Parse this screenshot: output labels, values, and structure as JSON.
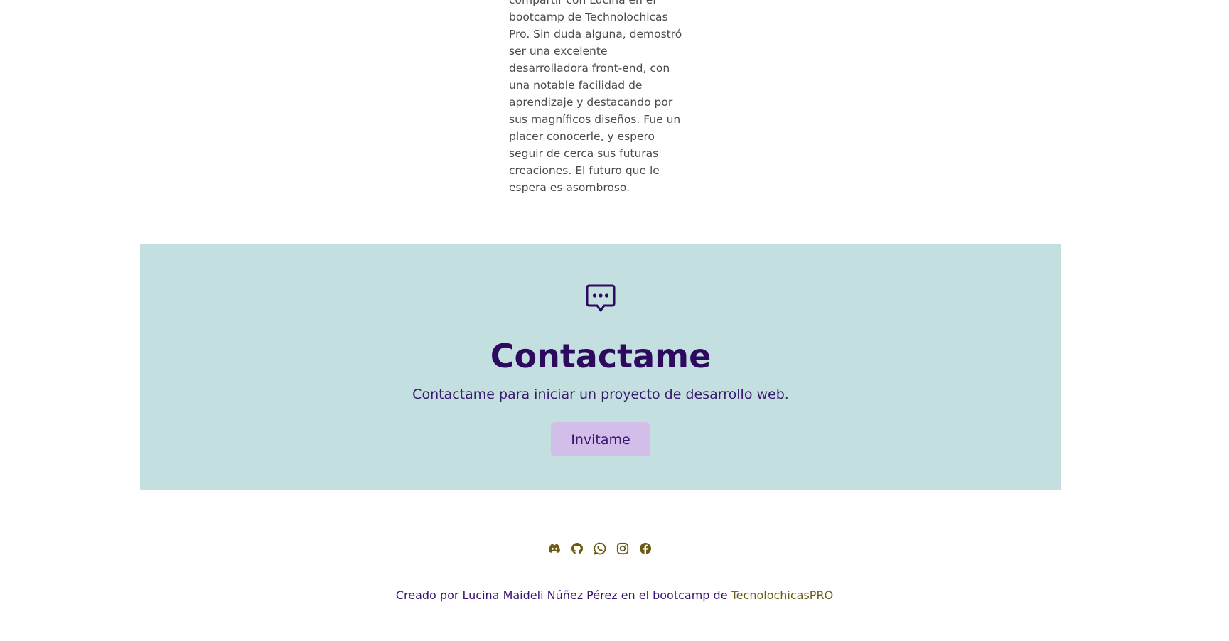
{
  "testimonial": {
    "lines": [
      "compartir con Lucina en el",
      "bootcamp de Technolochicas",
      "Pro. Sin duda alguna, demostró",
      "ser una excelente",
      "desarrolladora front-end, con",
      "una notable facilidad de",
      "aprendizaje y destacando por",
      "sus magníficos diseños. Fue un",
      "placer conocerle, y espero",
      "seguir de cerca sus futuras",
      "creaciones. El futuro que le",
      "espera es asombroso."
    ]
  },
  "contact": {
    "icon": "chat-bubble-dots-icon",
    "title": "Contactame",
    "subtitle": "Contactame para iniciar un proyecto de desarrollo web.",
    "button_label": "Invitame",
    "background_color": "#c4dfe0",
    "title_color": "#2d0a5e",
    "button_color": "#d3bde9"
  },
  "social": {
    "icons": [
      "discord-icon",
      "github-icon",
      "whatsapp-icon",
      "instagram-icon",
      "facebook-icon"
    ],
    "icon_color": "#6b5a14"
  },
  "footer": {
    "text": "Creado por Lucina Maideli Núñez Pérez en el bootcamp de ",
    "link_text": "TecnolochicasPRO",
    "text_color": "#3a1470",
    "link_color": "#6b5a14"
  }
}
